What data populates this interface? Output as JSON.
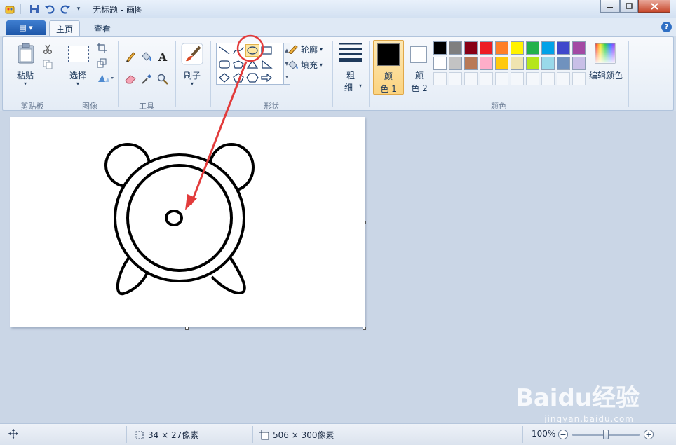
{
  "window": {
    "title": "无标题 - 画图"
  },
  "tabs": {
    "file_label": "▤ ▾",
    "home": "主页",
    "view": "查看"
  },
  "ribbon": {
    "clipboard": {
      "paste": "粘贴",
      "group": "剪贴板"
    },
    "image": {
      "select": "选择",
      "group": "图像"
    },
    "tools": {
      "text_icon": "A",
      "group": "工具"
    },
    "brushes": {
      "label": "刷子"
    },
    "shapes": {
      "outline": "轮廓",
      "fill": "填充",
      "group": "形状"
    },
    "size": {
      "label_top": "粗",
      "label_bottom": "细"
    },
    "colors": {
      "color1_top": "颜",
      "color1_bottom": "色 1",
      "color2_top": "颜",
      "color2_bottom": "色 2",
      "edit_colors": "编辑颜色",
      "group": "颜色",
      "color1_value": "#000000",
      "color2_value": "#ffffff",
      "palette_row1": [
        "#000000",
        "#7f7f7f",
        "#880015",
        "#ed1c24",
        "#ff7f27",
        "#fff200",
        "#22b14c",
        "#00a2e8",
        "#3f48cc",
        "#a349a4"
      ],
      "palette_row2": [
        "#ffffff",
        "#c3c3c3",
        "#b97a57",
        "#ffaec9",
        "#ffc90e",
        "#efe4b0",
        "#b5e61d",
        "#99d9ea",
        "#7092be",
        "#c8bfe7"
      ]
    }
  },
  "status": {
    "selection_size": "34 × 27像素",
    "canvas_size": "506 × 300像素",
    "zoom": "100%",
    "zoom_out": "−",
    "zoom_in": "+",
    "zoom_level_fraction": 0.5
  },
  "watermark": {
    "brand": "Baidu经验",
    "url": "jingyan.baidu.com"
  },
  "icons": {
    "quick_access": [
      "paint-app-icon",
      "save-icon",
      "undo-icon",
      "redo-icon",
      "customize-icon"
    ],
    "help": "help-icon"
  }
}
